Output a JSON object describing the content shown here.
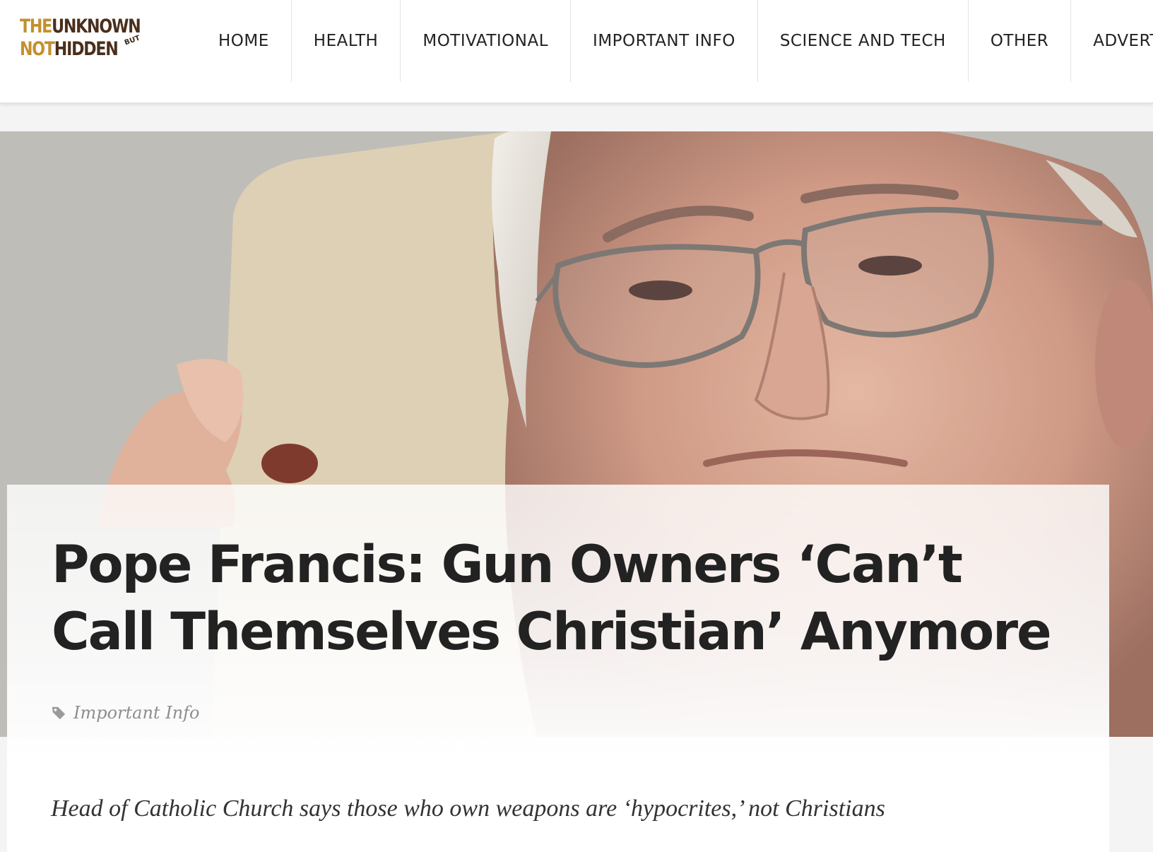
{
  "site": {
    "logo_line1": {
      "gold": "THE",
      "dark": "UNKNOWN"
    },
    "logo_line2": {
      "gold": "NOT",
      "dark": "HIDDEN"
    },
    "logo_small": "BUT"
  },
  "nav": {
    "items": [
      {
        "label": "HOME"
      },
      {
        "label": "HEALTH"
      },
      {
        "label": "MOTIVATIONAL"
      },
      {
        "label": "IMPORTANT INFO"
      },
      {
        "label": "SCIENCE AND TECH"
      },
      {
        "label": "OTHER"
      },
      {
        "label": "ADVERTI"
      }
    ]
  },
  "article": {
    "title": "Pope Francis: Gun Owners ‘Can’t Call Themselves Christian’ Anymore",
    "category": "Important Info",
    "category_icon": "tag-icon",
    "lead": "Head of Catholic Church says those who own weapons are ‘hypocrites,’ not Christians"
  },
  "colors": {
    "logo_gold": "#c3902f",
    "logo_dark": "#4a2f1c",
    "text": "#222222",
    "meta": "#8e8e8e"
  }
}
